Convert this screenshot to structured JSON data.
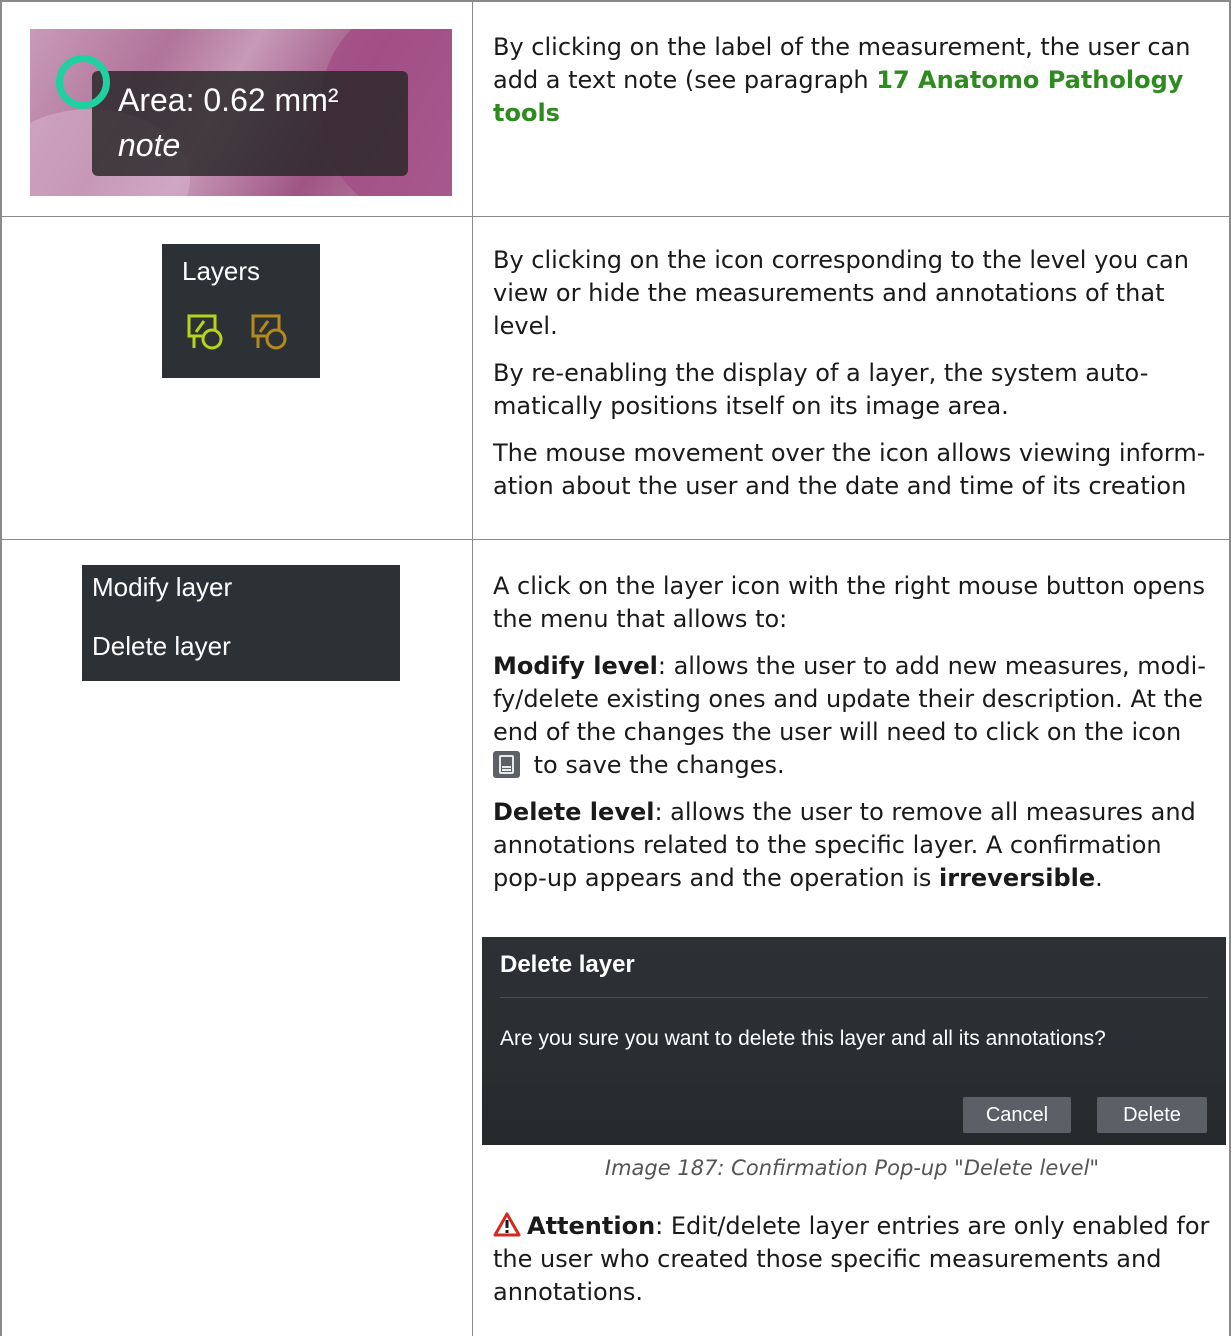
{
  "row1": {
    "image": {
      "measure_label": "Area: 0.62 mm²",
      "note_label": "note",
      "ring_color": "#1fd0a0"
    },
    "text_before": "By clicking on the label of the measurement, the user can add a text note (see paragraph ",
    "link": "17 Anatomo Pathology tools"
  },
  "row2": {
    "image": {
      "title": "Layers",
      "icon_active_color": "#b8d41a",
      "icon_inactive_color": "#b58a1c"
    },
    "paragraphs": [
      "By clicking on the icon corresponding to the level you can view or hide the measurements and annotations of that level.",
      "By re-enabling the display of a layer, the system auto-matically positions itself on its image area.",
      "The mouse movement over the icon allows viewing inform-ation about the user and the date and time of its creation"
    ]
  },
  "row3": {
    "menu": {
      "items": [
        "Modify layer",
        "Delete layer"
      ]
    },
    "intro": "A click on the layer icon with the right mouse button opens the menu that allows to:",
    "modify_term": "Modify level",
    "modify_desc_1": ": allows the user to add new measures, modi-fy/delete existing ones and update their description. At the end of the changes the user will need to click on the icon",
    "modify_desc_2": " to save the changes.",
    "delete_term": "Delete level",
    "delete_desc": ": allows the user to remove all measures and annotations related to the specific layer. A confirmation pop-up appears and the operation is ",
    "delete_emph": "irreversible",
    "delete_end": ".",
    "dialog": {
      "title": "Delete layer",
      "message": "Are you sure you want to delete this layer and all its annotations?",
      "cancel_label": "Cancel",
      "delete_label": "Delete"
    },
    "caption": "Image 187: Confirmation Pop-up \"Delete level\"",
    "attention_term": "Attention",
    "attention_desc": ": Edit/delete layer entries are only enabled for the user who created those specific measurements and annotations.",
    "warning_color": "#d42a1e"
  }
}
